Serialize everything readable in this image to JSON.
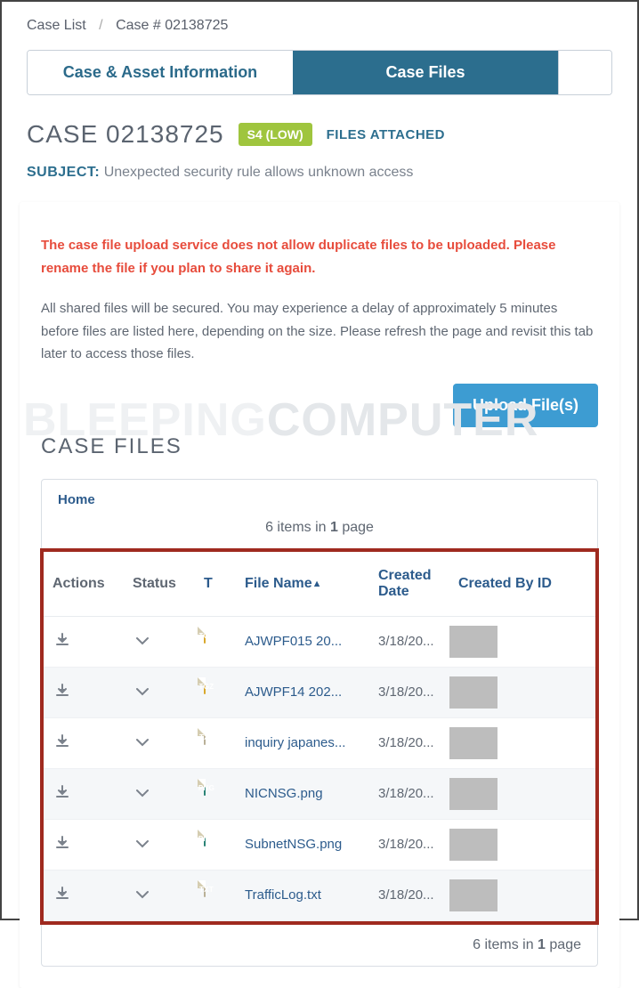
{
  "breadcrumb": {
    "root": "Case List",
    "current": "Case # 02138725"
  },
  "tabs": {
    "info": "Case & Asset Information",
    "files": "Case Files"
  },
  "case": {
    "title": "CASE 02138725",
    "severity": "S4 (LOW)",
    "attached_label": "FILES ATTACHED",
    "subject_label": "SUBJECT:",
    "subject_text": "Unexpected security rule allows unknown access"
  },
  "messages": {
    "warning": "The case file upload service does not allow duplicate files to be uploaded. Please rename the file if you plan to share it again.",
    "info": "All shared files will be secured. You may experience a delay of approximately 5 minutes before files are listed here, depending on the size. Please refresh the page and revisit this tab later to access those files."
  },
  "buttons": {
    "upload": "Upload File(s)"
  },
  "section": {
    "title": "CASE FILES",
    "home": "Home"
  },
  "pager": {
    "text_prefix": "6",
    "items_in": " items in ",
    "pages": "1",
    "page_suffix": " page"
  },
  "columns": {
    "actions": "Actions",
    "status": "Status",
    "t": "T",
    "filename": "File Name",
    "created_date": "Created Date",
    "created_by": "Created By ID"
  },
  "files": [
    {
      "type": "TGZ",
      "name": "AJWPF015 20...",
      "date": "3/18/20..."
    },
    {
      "type": "TGZ",
      "name": "AJWPF14 202...",
      "date": "3/18/20..."
    },
    {
      "type": "TXT",
      "name": "inquiry japanes...",
      "date": "3/18/20..."
    },
    {
      "type": "PNG",
      "name": "NICNSG.png",
      "date": "3/18/20..."
    },
    {
      "type": "PNG",
      "name": "SubnetNSG.png",
      "date": "3/18/20..."
    },
    {
      "type": "TXT",
      "name": "TrafficLog.txt",
      "date": "3/18/20..."
    }
  ],
  "watermark": {
    "left": "BLEEPING",
    "right": "COMPUTER"
  }
}
